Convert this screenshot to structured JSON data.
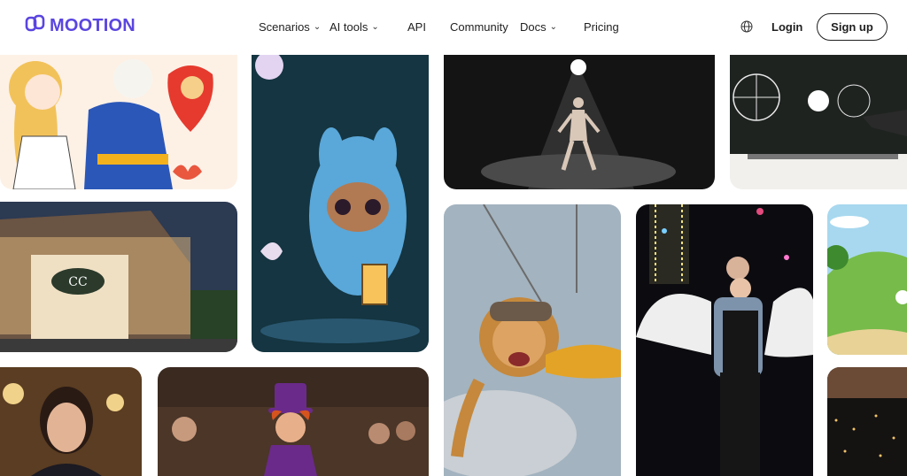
{
  "brand": {
    "name": "MOOTION"
  },
  "nav": {
    "items": [
      {
        "label": "Scenarios",
        "has_dropdown": true
      },
      {
        "label": "AI tools",
        "has_dropdown": true
      },
      {
        "label": "API",
        "has_dropdown": false
      },
      {
        "label": "Community",
        "has_dropdown": false
      },
      {
        "label": "Docs",
        "has_dropdown": true
      },
      {
        "label": "Pricing",
        "has_dropdown": false
      }
    ],
    "login_label": "Login",
    "signup_label": "Sign up"
  },
  "colors": {
    "brand": "#5a45e0",
    "text": "#1f1f1f",
    "background": "#ffffff"
  },
  "gallery": {
    "items": [
      {
        "name": "cartoon-couple-with-clock-heart"
      },
      {
        "name": "stage-dancer-spotlight"
      },
      {
        "name": "chalkboard-scientist-sketch"
      },
      {
        "name": "chanel-storefront-evening"
      },
      {
        "name": "blue-furry-creature-with-lantern"
      },
      {
        "name": "lion-skydiving-parachute"
      },
      {
        "name": "couple-with-angel-wings"
      },
      {
        "name": "cartoon-green-hills"
      },
      {
        "name": "smiling-woman-ballroom"
      },
      {
        "name": "animated-magician-top-hat-audience"
      },
      {
        "name": "night-city-skyline"
      }
    ]
  }
}
